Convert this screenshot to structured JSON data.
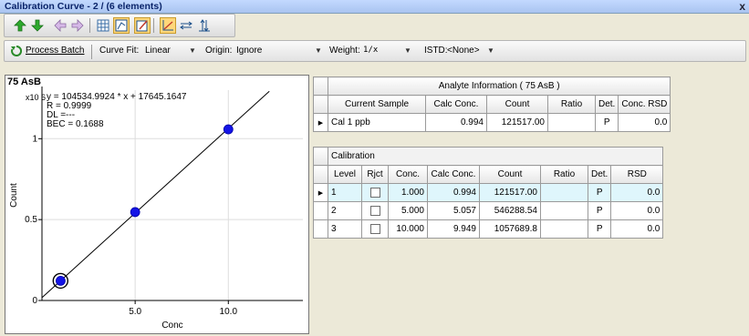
{
  "window": {
    "title": "Calibration Curve - 2 / (6 elements)",
    "close": "x"
  },
  "toolbar": {
    "process_batch": "Process Batch",
    "curve_fit_label": "Curve Fit:",
    "curve_fit_value": "Linear",
    "origin_label": "Origin:",
    "origin_value": "Ignore",
    "weight_label": "Weight:",
    "weight_value": "1/x",
    "istd_label": "ISTD:",
    "istd_value": "<None>"
  },
  "chart": {
    "element_label": "75  AsB",
    "equation": "y = 104534.9924 * x + 17645.1647",
    "r_value": "R = 0.9999",
    "dl_value": "DL =---",
    "bec_value": "BEC = 0.1688"
  },
  "chart_data": {
    "type": "scatter",
    "xlabel": "Conc",
    "ylabel": "Count",
    "y_multiplier": "x10 6",
    "x_ticks": [
      "5.0",
      "10.0"
    ],
    "y_ticks": [
      "0",
      "0.5",
      "1"
    ],
    "xlim": [
      0,
      14
    ],
    "ylim": [
      0,
      1.3
    ],
    "fit": {
      "slope": 104534.9924,
      "intercept": 17645.1647
    },
    "points": [
      {
        "x": 1.0,
        "y": 0.121517
      },
      {
        "x": 5.0,
        "y": 0.546288
      },
      {
        "x": 10.0,
        "y": 1.057689
      }
    ],
    "current_sample": {
      "x": 0.994,
      "y": 0.121517
    },
    "grid": true,
    "point_color": "#1414e6"
  },
  "analyte": {
    "title": "Analyte Information ( 75  AsB )",
    "headers": [
      "Current Sample",
      "Calc Conc.",
      "Count",
      "Ratio",
      "Det.",
      "Conc. RSD"
    ],
    "row": {
      "sample": "Cal 1 ppb",
      "calc_conc": "0.994",
      "count": "121517.00",
      "ratio": "",
      "det": "P",
      "rsd": "0.0"
    }
  },
  "calibration": {
    "title": "Calibration",
    "headers": [
      "Level",
      "Rjct",
      "Conc.",
      "Calc Conc.",
      "Count",
      "Ratio",
      "Det.",
      "RSD"
    ],
    "rows": [
      {
        "level": "1",
        "conc": "1.000",
        "calc_conc": "0.994",
        "count": "121517.00",
        "ratio": "",
        "det": "P",
        "rsd": "0.0"
      },
      {
        "level": "2",
        "conc": "5.000",
        "calc_conc": "5.057",
        "count": "546288.54",
        "ratio": "",
        "det": "P",
        "rsd": "0.0"
      },
      {
        "level": "3",
        "conc": "10.000",
        "calc_conc": "9.949",
        "count": "1057689.8",
        "ratio": "",
        "det": "P",
        "rsd": "0.0"
      }
    ]
  },
  "icons": {
    "up": "green-up-arrow-icon",
    "down": "green-down-arrow-icon",
    "left": "purple-left-arrow-icon",
    "right": "purple-right-arrow-icon"
  }
}
